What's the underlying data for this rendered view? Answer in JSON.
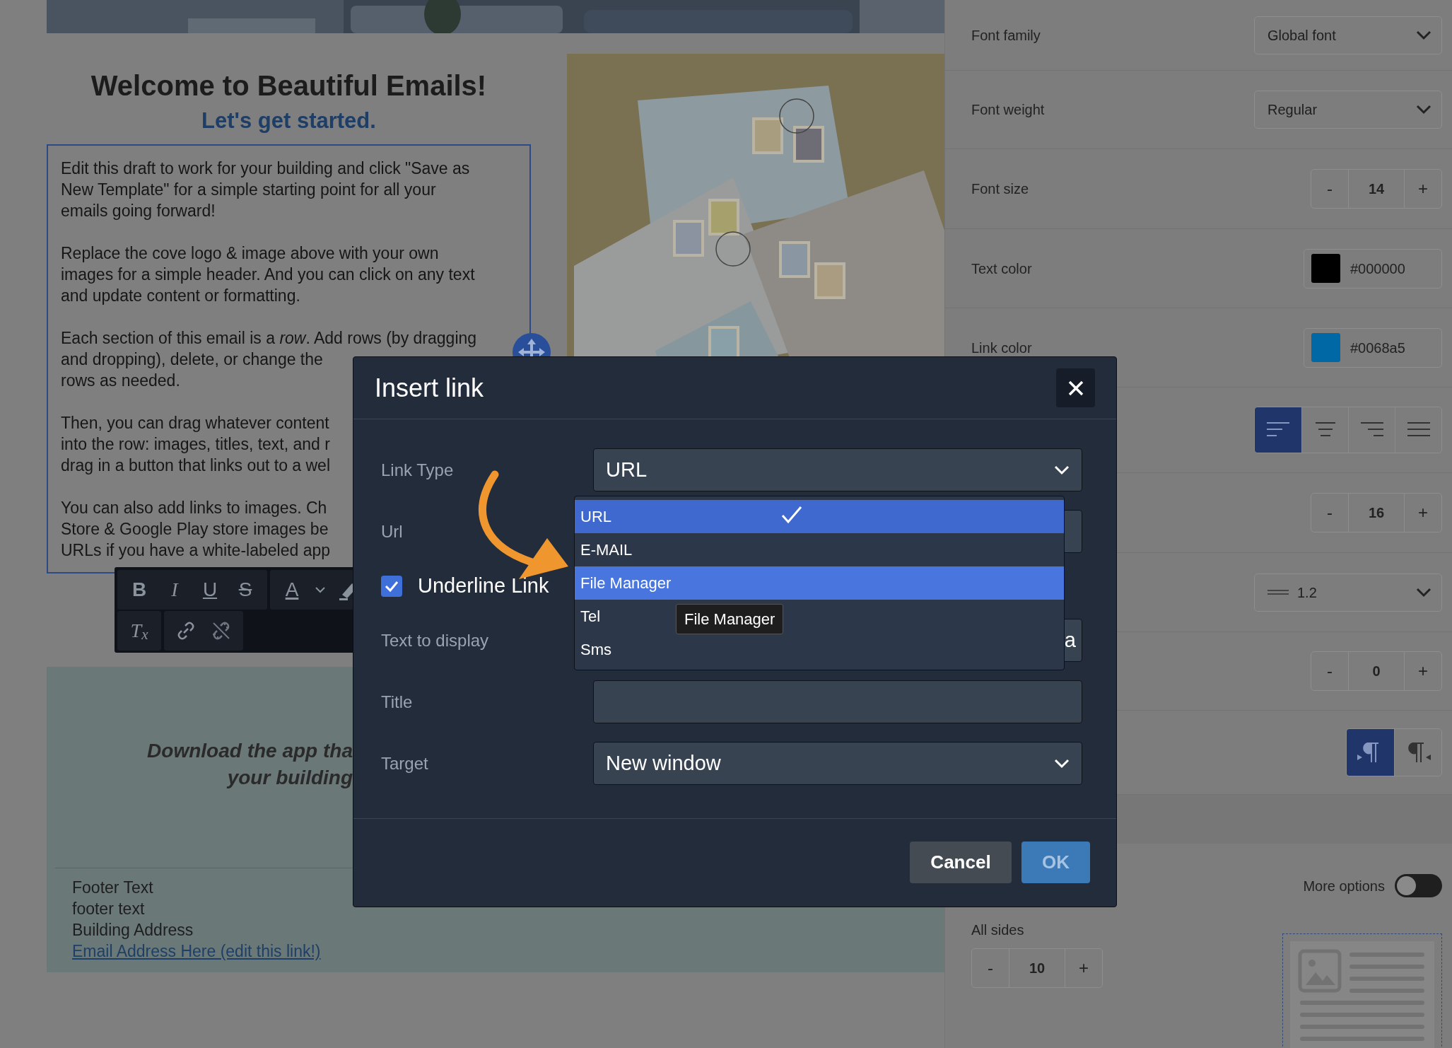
{
  "email": {
    "heading": "Welcome to Beautiful Emails!",
    "subheading": "Let's get started.",
    "paragraphs": [
      [
        "Edit this draft to work for your building and click \"Save as",
        "New Template\" for a simple starting point for all your",
        "emails going forward!"
      ],
      [
        "Replace the cove logo & image above with your own",
        "images for a simple header. And you can click on any text",
        "and update content or formatting."
      ],
      [
        "Each section of this email is a *row*. Add rows (by dragging",
        "and dropping), delete, or change the",
        "rows as needed."
      ],
      [
        "Then, you can drag whatever content",
        "into the row: images, titles, text, and r",
        "drag in a button that links out to a wel"
      ],
      [
        "You can also add links to images. Ch",
        "Store & Google Play store images be",
        "URLs if you have a white-labeled app"
      ]
    ],
    "banner": [
      "Download the app tha",
      "your building"
    ],
    "footer": [
      "Footer Text",
      "footer text",
      "Building Address"
    ],
    "footer_link": "Email Address Here (edit this link!)"
  },
  "toolbar": {
    "rows": [
      {
        "groups": [
          [
            {
              "kind": "bold",
              "label": "B"
            },
            {
              "kind": "italic",
              "label": "I"
            },
            {
              "kind": "underline",
              "label": "U"
            },
            {
              "kind": "strike",
              "label": "S"
            }
          ],
          [
            {
              "kind": "color",
              "label": "A"
            },
            {
              "kind": "caret"
            },
            {
              "kind": "highlight"
            }
          ]
        ]
      },
      {
        "groups": [
          [
            {
              "kind": "clear",
              "label": "T$_{x}$"
            }
          ],
          [
            {
              "kind": "link"
            },
            {
              "kind": "unlink"
            }
          ]
        ]
      }
    ]
  },
  "settings": [
    {
      "kind": "select",
      "label": "Font family",
      "value": "Global font"
    },
    {
      "kind": "select",
      "label": "Font weight",
      "value": "Regular"
    },
    {
      "kind": "stepper",
      "label": "Font size",
      "value": "14",
      "decrement": "-",
      "increment": "+"
    },
    {
      "kind": "color",
      "label": "Text color",
      "value": "#000000",
      "color": "#000000"
    },
    {
      "kind": "color",
      "label": "Link color",
      "value": "#0068a5",
      "color": "#0068a5"
    },
    {
      "kind": "align",
      "options": [
        {
          "kind": "left",
          "selected": true
        },
        {
          "kind": "center",
          "selected": false
        },
        {
          "kind": "right",
          "selected": false
        },
        {
          "kind": "justify",
          "selected": false
        }
      ]
    },
    {
      "kind": "stepper",
      "value": "16",
      "decrement": "-",
      "increment": "+"
    },
    {
      "kind": "spacing-select",
      "value": "1.2"
    },
    {
      "kind": "stepper",
      "value": "0",
      "decrement": "-",
      "increment": "+"
    },
    {
      "kind": "direction",
      "options": [
        {
          "kind": "ltr",
          "selected": true
        },
        {
          "kind": "rtl",
          "selected": false
        }
      ]
    }
  ],
  "more_options": {
    "label": "More options",
    "on": false
  },
  "padding": {
    "label": "All sides",
    "value": "10",
    "decrement": "-",
    "increment": "+"
  },
  "dialog": {
    "title": "Insert link",
    "fields": [
      {
        "kind": "select",
        "label": "Link Type",
        "value": "URL"
      },
      {
        "kind": "input",
        "label": "Url"
      },
      {
        "kind": "checkbox",
        "label": "Underline Link",
        "checked": true
      },
      {
        "kind": "input",
        "label": "Text to display",
        "value": "a"
      },
      {
        "kind": "input",
        "label": "Title"
      },
      {
        "kind": "select",
        "label": "Target",
        "value": "New window"
      }
    ],
    "dropdown": [
      {
        "label": "URL",
        "selected": true,
        "hovered": false
      },
      {
        "label": "E-MAIL",
        "selected": false,
        "hovered": false
      },
      {
        "label": "File Manager",
        "selected": false,
        "hovered": true
      },
      {
        "label": "Tel",
        "selected": false,
        "hovered": false
      },
      {
        "label": "Sms",
        "selected": false,
        "hovered": false
      }
    ],
    "tooltip": "File Manager",
    "buttons": [
      {
        "kind": "secondary",
        "label": "Cancel"
      },
      {
        "kind": "primary",
        "label": "OK"
      }
    ]
  }
}
